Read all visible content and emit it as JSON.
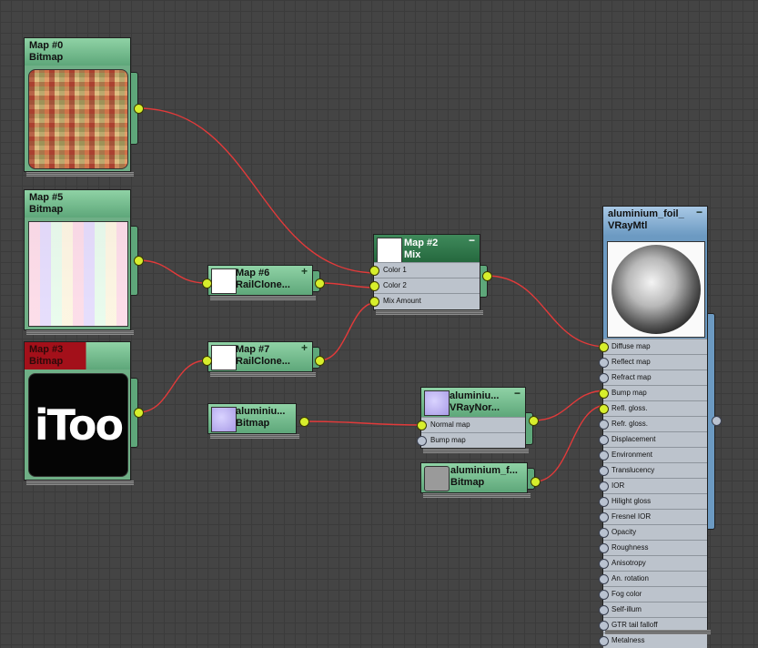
{
  "nodes": {
    "map0": {
      "name": "Map #0",
      "type": "Bitmap"
    },
    "map5": {
      "name": "Map #5",
      "type": "Bitmap"
    },
    "map3": {
      "name": "Map #3",
      "type": "Bitmap",
      "thumb_text": "iToo"
    },
    "map6": {
      "name": "Map #6",
      "type": "RailClone..."
    },
    "map7": {
      "name": "Map #7",
      "type": "RailClone..."
    },
    "map2": {
      "name": "Map #2",
      "type": "Mix",
      "slots": [
        "Color 1",
        "Color 2",
        "Mix Amount"
      ]
    },
    "alu_bitmap_left": {
      "name": "aluminiu...",
      "type": "Bitmap"
    },
    "alu_vraynormal": {
      "name": "aluminiu...",
      "type": "VRayNor...",
      "slots": [
        "Normal map",
        "Bump map"
      ]
    },
    "alu_bitmap_f": {
      "name": "aluminium_f...",
      "type": "Bitmap"
    },
    "material": {
      "name": "aluminium_foil_",
      "type": "VRayMtl",
      "slots": [
        "Diffuse map",
        "Reflect map",
        "Refract map",
        "Bump map",
        "Refl. gloss.",
        "Refr. gloss.",
        "Displacement",
        "Environment",
        "Translucency",
        "IOR",
        "Hilight gloss",
        "Fresnel IOR",
        "Opacity",
        "Roughness",
        "Anisotropy",
        "An. rotation",
        "Fog color",
        "Self-illum",
        "GTR tail falloff",
        "Metalness"
      ]
    }
  },
  "colors": {
    "node_green": "#6faf86",
    "material_blue": "#6c9ac2",
    "socket_active": "#d7ee2c",
    "wire": "#e23a3a",
    "mix_header": "#2f7a4b"
  }
}
